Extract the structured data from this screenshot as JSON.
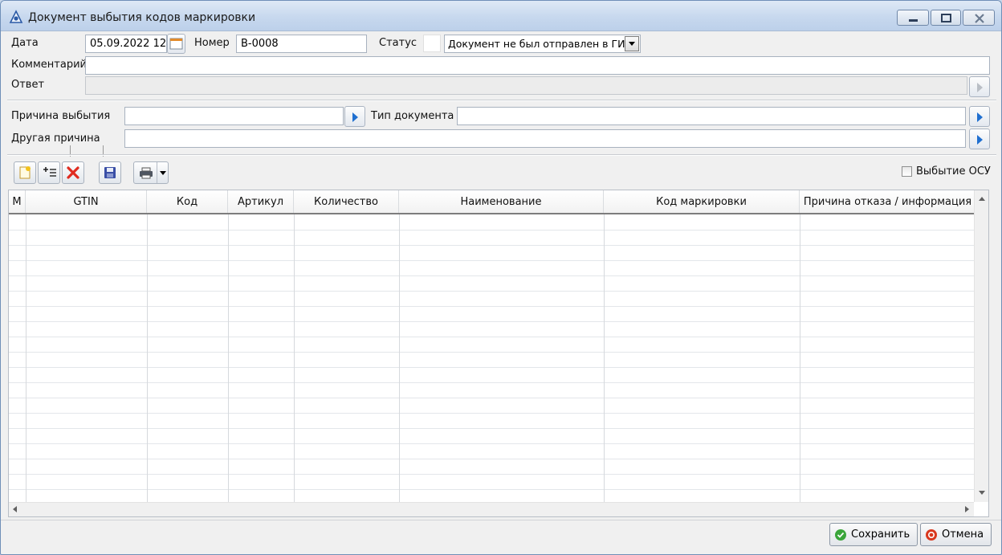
{
  "window": {
    "title": "Документ выбытия кодов маркировки"
  },
  "form": {
    "date_label": "Дата",
    "date_value": "05.09.2022 12",
    "number_label": "Номер",
    "number_value": "В-0008",
    "status_label": "Статус",
    "status_value": "Документ не был отправлен в ГИС",
    "comment_label": "Комментарий",
    "comment_value": "",
    "answer_label": "Ответ",
    "answer_value": "",
    "reason_label": "Причина выбытия",
    "reason_value": "",
    "doctype_label": "Тип документа",
    "doctype_value": "",
    "other_reason_label": "Другая причина",
    "other_reason_value": ""
  },
  "toolbar": {
    "icons": [
      "add-icon",
      "add-row-icon",
      "delete-icon",
      "save-icon",
      "print-icon"
    ],
    "osu_label": "Выбытие ОСУ",
    "osu_checked": false
  },
  "table": {
    "columns": [
      "М",
      "GTIN",
      "Код",
      "Артикул",
      "Количество",
      "Наименование",
      "Код маркировки",
      "Причина отказа / информация"
    ],
    "rows": []
  },
  "buttons": {
    "save_label": "Сохранить",
    "cancel_label": "Отмена"
  },
  "colors": {
    "accent_arrow": "#1f6fd0",
    "save_icon": "#3aa53a",
    "cancel_icon": "#d9381e"
  }
}
